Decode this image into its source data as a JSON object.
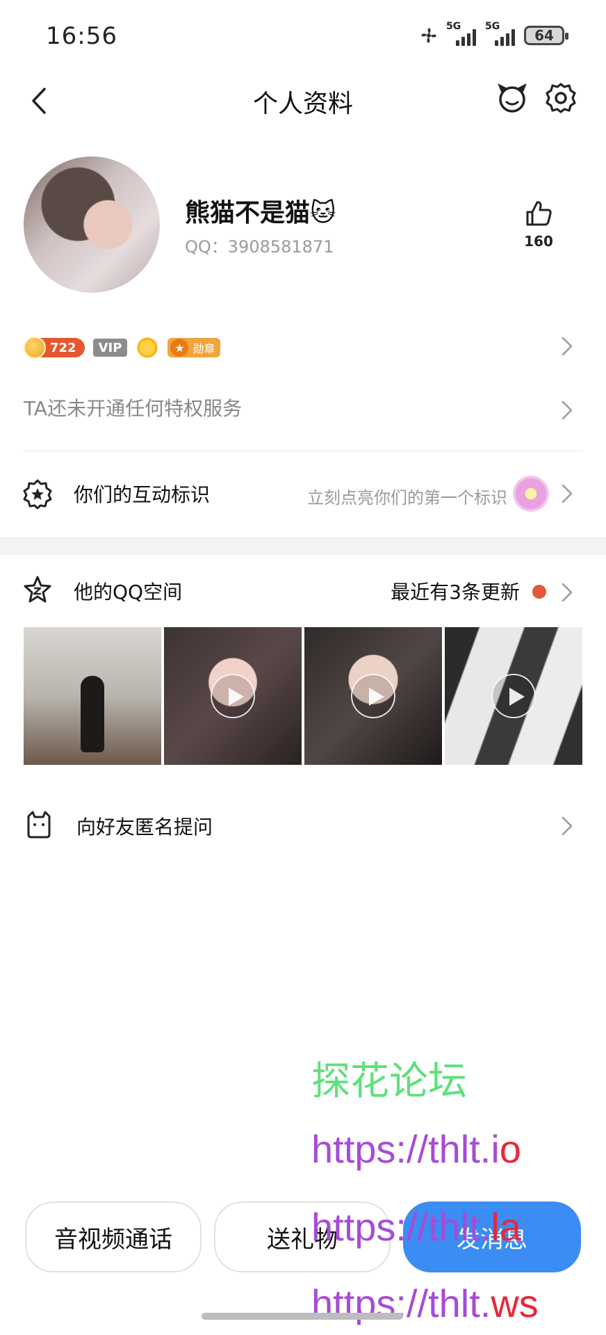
{
  "status_bar": {
    "time": "16:56",
    "signal_1_label": "5G",
    "signal_2_label": "5G",
    "battery": "64"
  },
  "nav": {
    "title": "个人资料",
    "icons": [
      "back-arrow-icon",
      "pet-icon",
      "gear-icon"
    ]
  },
  "profile": {
    "nickname": "熊猫不是猫🐱",
    "qq_number": "QQ：3908581871",
    "like_count": "160"
  },
  "badges": {
    "level": "722",
    "vip": "VIP",
    "medal": "勋章"
  },
  "privilege_text": "TA还未开通任何特权服务",
  "interaction": {
    "title": "你们的互动标识",
    "hint": "立刻点亮你们的第一个标识"
  },
  "qzone": {
    "title": "他的QQ空间",
    "update": "最近有3条更新",
    "photos": [
      {
        "video": false
      },
      {
        "video": true
      },
      {
        "video": true
      },
      {
        "video": true
      }
    ]
  },
  "ask": {
    "title": "向好友匿名提问"
  },
  "watermark": {
    "line1": "探花论坛",
    "line2_a": "https://thlt.i",
    "line2_b": "o",
    "line3_a": "https://thlt.",
    "line3_b": "la",
    "line4_a": "https://thlt.",
    "line4_b": "ws"
  },
  "actions": {
    "call": "音视频通话",
    "gift": "送礼物",
    "message": "发消息"
  },
  "colors": {
    "accent_blue": "#3b8cf3",
    "update_dot": "#e25a3b",
    "watermark_green": "#5fe07c",
    "watermark_purple": "#a64bd6",
    "watermark_red": "#e8273b"
  }
}
